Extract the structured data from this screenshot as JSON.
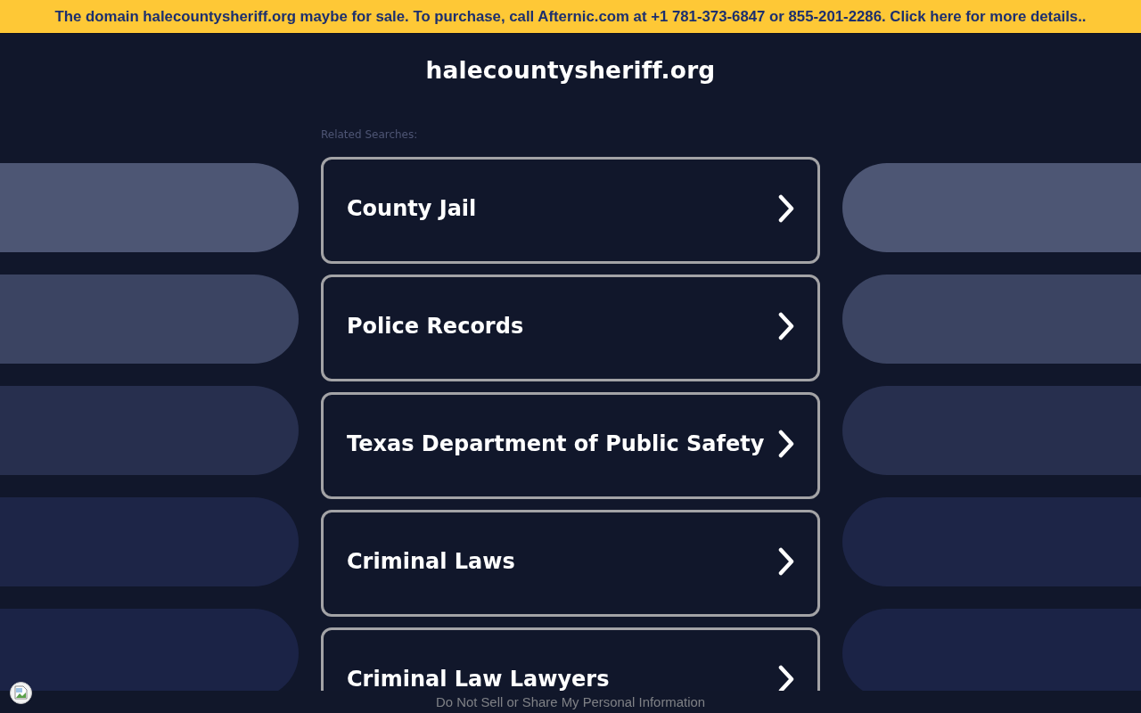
{
  "banner": {
    "text": "The domain halecountysheriff.org maybe for sale. To purchase, call Afternic.com at +1 781-373-6847 or 855-201-2286. Click here for more details.."
  },
  "header": {
    "title": "halecountysheriff.org"
  },
  "related_searches": {
    "label": "Related Searches:",
    "items": [
      {
        "label": "County Jail"
      },
      {
        "label": "Police Records"
      },
      {
        "label": "Texas Department of Public Safety"
      },
      {
        "label": "Criminal Laws"
      },
      {
        "label": "Criminal Law Lawyers"
      }
    ]
  },
  "footer": {
    "link": "Do Not Sell or Share My Personal Information"
  }
}
